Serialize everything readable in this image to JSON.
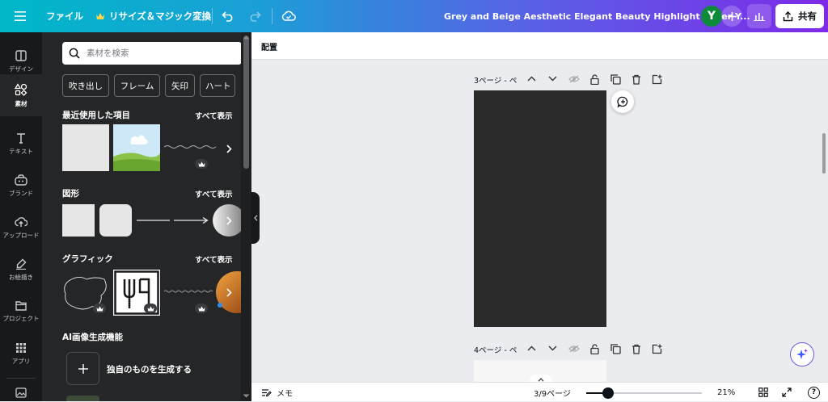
{
  "topbar": {
    "file_label": "ファイル",
    "resize_label": "リサイズ＆マジック変換",
    "doc_title": "Grey and Beige Aesthetic Elegant Beauty  Highlight Cover Y...",
    "avatar_letter": "Y",
    "share_label": "共有",
    "accent": "#7d2ae8"
  },
  "rail": {
    "items": [
      {
        "label": "デザイン",
        "icon": "design-icon"
      },
      {
        "label": "素材",
        "icon": "elements-icon"
      },
      {
        "label": "テキスト",
        "icon": "text-icon"
      },
      {
        "label": "ブランド",
        "icon": "brand-icon"
      },
      {
        "label": "アップロード",
        "icon": "upload-icon"
      },
      {
        "label": "お絵描き",
        "icon": "draw-icon"
      },
      {
        "label": "プロジェクト",
        "icon": "folder-icon"
      },
      {
        "label": "アプリ",
        "icon": "apps-icon"
      }
    ]
  },
  "panel": {
    "search_placeholder": "素材を検索",
    "chips": [
      "吹き出し",
      "フレーム",
      "矢印",
      "ハート"
    ],
    "recent": {
      "title": "最近使用した項目",
      "see_all": "すべて表示"
    },
    "shapes": {
      "title": "図形",
      "see_all": "すべて表示"
    },
    "graphics": {
      "title": "グラフィック",
      "see_all": "すべて表示"
    },
    "ai": {
      "title": "AI画像生成機能",
      "generate_label": "独自のものを生成する"
    }
  },
  "canvas": {
    "subbar_label": "配置",
    "page3_label": "3ページ - ペ",
    "page4_label": "4ページ - ペ",
    "page_dark_color": "#2b2b2b"
  },
  "bottombar": {
    "notes_label": "メモ",
    "page_indicator": "3/9ページ",
    "zoom_label": "21%",
    "zoom_level": 0.21,
    "help_label": "?"
  }
}
